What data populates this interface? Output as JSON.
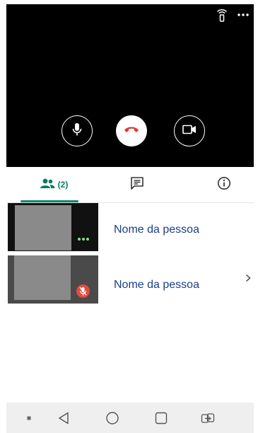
{
  "call": {
    "top_icons": [
      "remote-signal-icon",
      "more-options-icon"
    ],
    "controls": [
      "microphone-icon",
      "end-call-icon",
      "camera-icon"
    ],
    "end_call_color": "#e0382e"
  },
  "tabs": [
    {
      "icon": "people-icon",
      "count_label": "(2)",
      "selected": true
    },
    {
      "icon": "chat-icon"
    },
    {
      "icon": "info-icon"
    }
  ],
  "accent_color": "#0f8a6c",
  "participants": [
    {
      "name": "Nome da pessoa",
      "status_icon": "more-dots-icon"
    },
    {
      "name": "Nome da pessoa",
      "status_icon": "mic-off-icon"
    }
  ],
  "navbar": [
    "menu-dot-icon",
    "back-icon",
    "home-icon",
    "recents-icon",
    "switch-icon"
  ]
}
